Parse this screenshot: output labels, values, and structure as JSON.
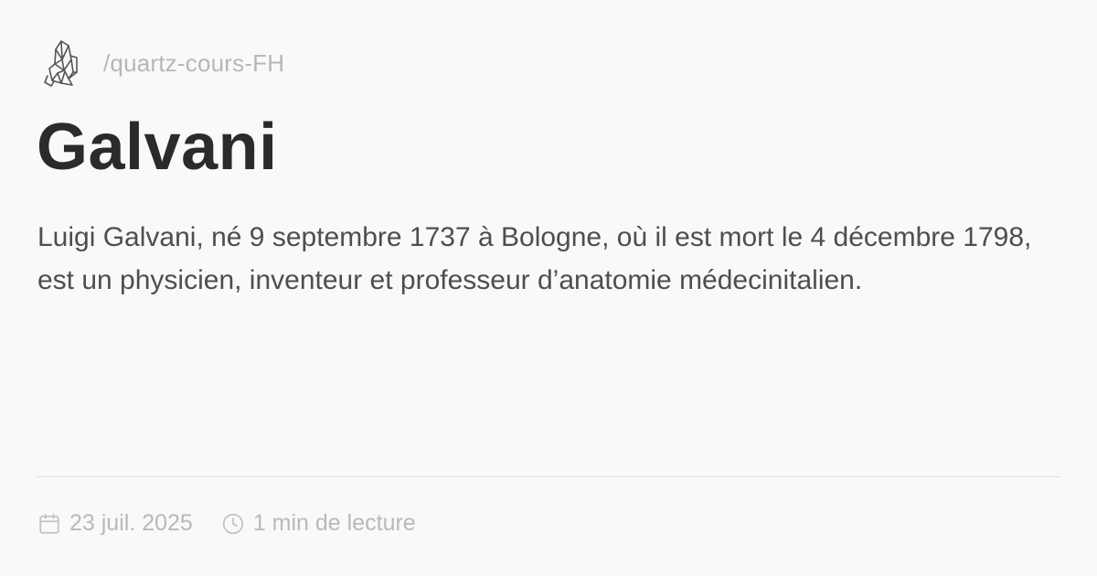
{
  "site": {
    "path": "/quartz-cours-FH",
    "logo_icon": "crystal-icon"
  },
  "page": {
    "title": "Galvani",
    "description": "Luigi Galvani, né 9 septembre 1737 à Bologne, où il est mort le 4 décembre 1798, est un physicien, inventeur et professeur d’anatomie médecinitalien."
  },
  "meta": {
    "date": "23 juil. 2025",
    "date_icon": "calendar-icon",
    "reading_time": "1 min de lecture",
    "reading_time_icon": "clock-icon"
  },
  "colors": {
    "background": "#faf8f8",
    "title": "#2b2b2b",
    "body_text": "#4e4e4e",
    "muted_text": "#b9b9b9",
    "divider": "#e5e3e3"
  }
}
